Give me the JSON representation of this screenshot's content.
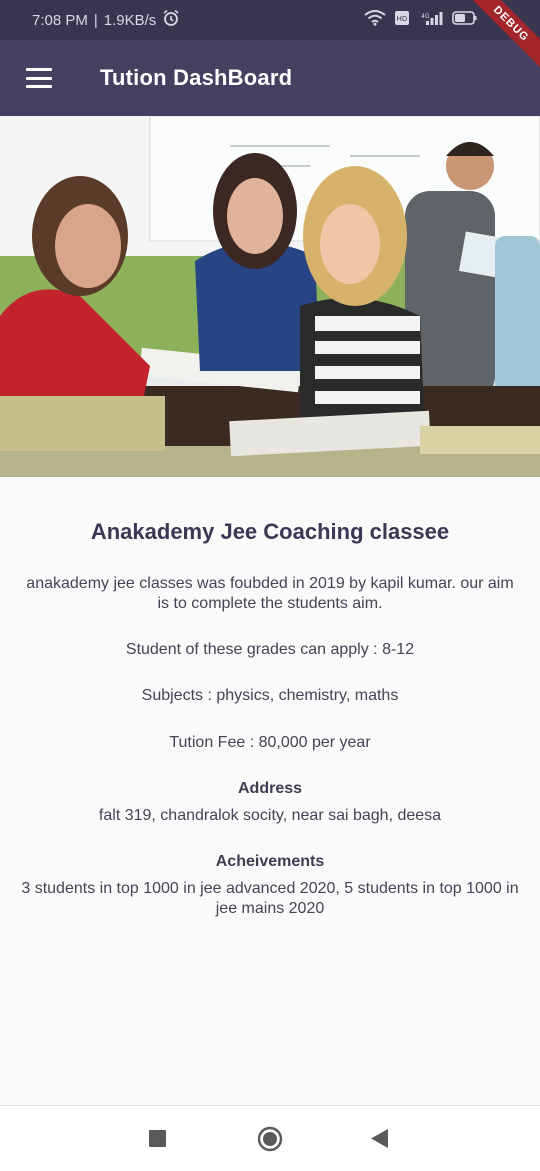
{
  "status_bar": {
    "time": "7:08 PM",
    "network_speed": "1.9KB/s",
    "icons": [
      "alarm-icon",
      "wifi-icon",
      "volte-icon",
      "signal-icon",
      "battery-icon"
    ]
  },
  "debug_banner": "DEBUG",
  "app_bar": {
    "title": "Tution DashBoard",
    "menu_icon": "hamburger-menu-icon",
    "background": "#463f60"
  },
  "hero_image": {
    "subject": "students-in-classroom-photo"
  },
  "content": {
    "title": "Anakademy Jee Coaching classee",
    "description": "anakademy jee classes was foubded in 2019 by kapil kumar. our aim is to complete the students aim.",
    "grades": "Student of these grades can apply : 8-12",
    "subjects": "Subjects : physics, chemistry, maths",
    "fee": "Tution Fee : 80,000 per year",
    "address_label": "Address",
    "address": "falt 319, chandralok socity, near sai bagh, deesa",
    "achievements_label": "Acheivements",
    "achievements": "3 students in top 1000 in jee advanced 2020,  5 students in top 1000 in jee mains 2020"
  },
  "nav_bar": {
    "buttons": [
      "recents-square-icon",
      "home-circle-icon",
      "back-triangle-icon"
    ]
  }
}
